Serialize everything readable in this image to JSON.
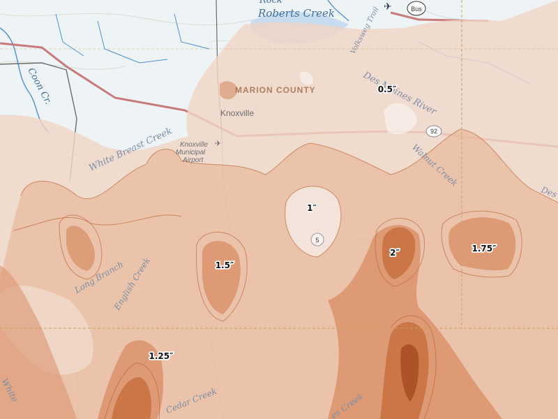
{
  "map": {
    "colors": {
      "base": "#eef3f6",
      "water": "#4a8fd0",
      "road": "#c97a7a",
      "shade_light": "#f3dfd5",
      "shade_mid": "#e7b797",
      "shade_dark": "#cc7745",
      "shade_darkest": "#a24a1c",
      "grid": "#c9a15a"
    },
    "water_labels": {
      "roberts_creek": "Roberts Creek",
      "rock": "Rock",
      "coon_creek": "Coon Cr."
    },
    "creek_labels": {
      "white_breast": "White Breast Creek",
      "des_moines": "Des Moines River",
      "walnut": "Walnut Creek",
      "long_branch": "Long Branch",
      "english": "English Creek",
      "cedar": "Cedar Creek",
      "white_edge": "White",
      "des_edge": "Des",
      "volksweg": "Volksweg Trail",
      "bottom_creek": "es Creek"
    },
    "places": {
      "county": "MARION COUNTY",
      "city": "Knoxville",
      "airport_line1": "Knoxville",
      "airport_line2": "Municipal",
      "airport_line3": "Airport"
    },
    "shields": {
      "bus": "Bus",
      "route_92": "92",
      "route_5": "5"
    },
    "rainfall_labels": [
      {
        "id": "half",
        "value": "0.5″"
      },
      {
        "id": "one",
        "value": "1″"
      },
      {
        "id": "one_half",
        "value": "1.5″"
      },
      {
        "id": "two",
        "value": "2″"
      },
      {
        "id": "one_three_quarter",
        "value": "1.75″"
      },
      {
        "id": "one_quarter",
        "value": "1.25″"
      }
    ]
  }
}
